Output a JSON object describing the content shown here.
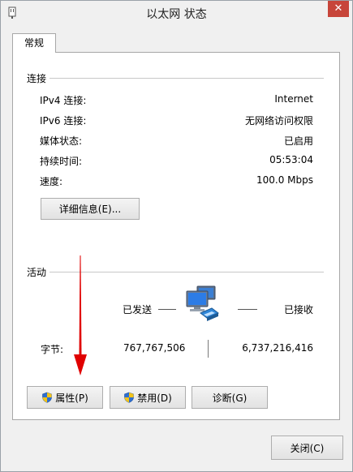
{
  "window": {
    "title": "以太网 状态",
    "close_glyph": "✕"
  },
  "tabs": [
    {
      "label": "常规"
    }
  ],
  "connection": {
    "group_label": "连接",
    "rows": [
      {
        "label": "IPv4 连接:",
        "value": "Internet"
      },
      {
        "label": "IPv6 连接:",
        "value": "无网络访问权限"
      },
      {
        "label": "媒体状态:",
        "value": "已启用"
      },
      {
        "label": "持续时间:",
        "value": "05:53:04"
      },
      {
        "label": "速度:",
        "value": "100.0 Mbps"
      }
    ],
    "details_button": "详细信息(E)..."
  },
  "activity": {
    "group_label": "活动",
    "sent_label": "已发送",
    "received_label": "已接收",
    "bytes_label": "字节:",
    "bytes_sent": "767,767,506",
    "bytes_received": "6,737,216,416"
  },
  "buttons": {
    "properties": "属性(P)",
    "disable": "禁用(D)",
    "diagnose": "诊断(G)",
    "close": "关闭(C)"
  },
  "colors": {
    "close_button": "#c7453a",
    "annotation_arrow": "#e00000"
  }
}
